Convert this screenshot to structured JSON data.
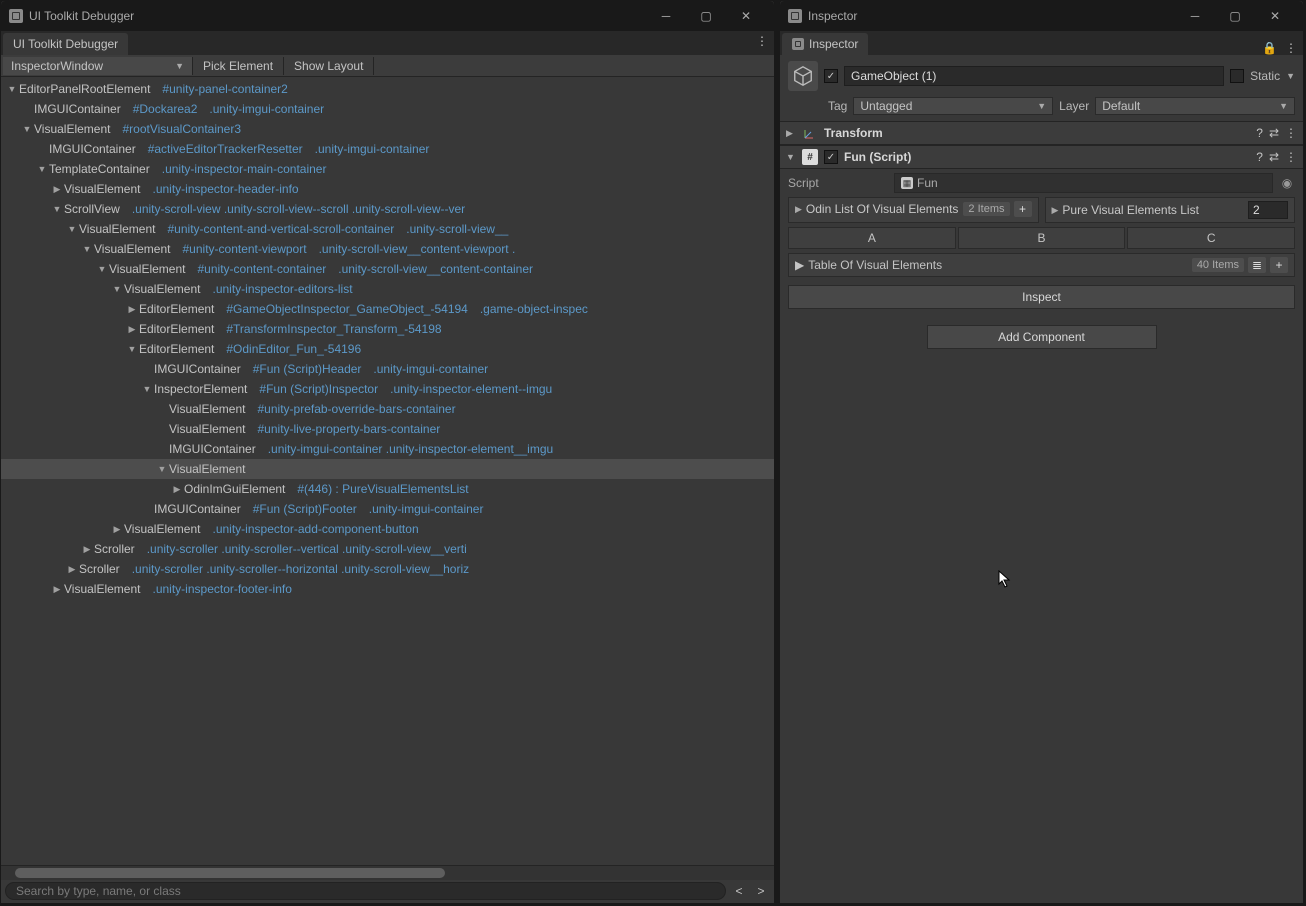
{
  "left": {
    "title": "UI Toolkit Debugger",
    "tab": "UI Toolkit Debugger",
    "dropdown": "InspectorWindow",
    "pick": "Pick Element",
    "showLayout": "Show Layout",
    "searchPlaceholder": "Search by type, name, or class",
    "nav_prev": "<",
    "nav_next": ">",
    "tree": [
      {
        "d": 0,
        "f": "▼",
        "n": "EditorPanelRootElement",
        "sel": "#unity-panel-container2"
      },
      {
        "d": 1,
        "f": "",
        "n": "IMGUIContainer",
        "sel": "#Dockarea2",
        "cls": ".unity-imgui-container"
      },
      {
        "d": 1,
        "f": "▼",
        "n": "VisualElement",
        "sel": "#rootVisualContainer3"
      },
      {
        "d": 2,
        "f": "",
        "n": "IMGUIContainer",
        "sel": "#activeEditorTrackerResetter",
        "cls": ".unity-imgui-container"
      },
      {
        "d": 2,
        "f": "▼",
        "n": "TemplateContainer",
        "cls": ".unity-inspector-main-container"
      },
      {
        "d": 3,
        "f": "▶",
        "n": "VisualElement",
        "cls": ".unity-inspector-header-info"
      },
      {
        "d": 3,
        "f": "▼",
        "n": "ScrollView",
        "cls": ".unity-scroll-view   .unity-scroll-view--scroll   .unity-scroll-view--ver"
      },
      {
        "d": 4,
        "f": "▼",
        "n": "VisualElement",
        "sel": "#unity-content-and-vertical-scroll-container",
        "cls": ".unity-scroll-view__"
      },
      {
        "d": 5,
        "f": "▼",
        "n": "VisualElement",
        "sel": "#unity-content-viewport",
        "cls": ".unity-scroll-view__content-viewport   ."
      },
      {
        "d": 6,
        "f": "▼",
        "n": "VisualElement",
        "sel": "#unity-content-container",
        "cls": ".unity-scroll-view__content-container"
      },
      {
        "d": 7,
        "f": "▼",
        "n": "VisualElement",
        "cls": ".unity-inspector-editors-list"
      },
      {
        "d": 8,
        "f": "▶",
        "n": "EditorElement",
        "sel": "#GameObjectInspector_GameObject_-54194",
        "cls": ".game-object-inspec"
      },
      {
        "d": 8,
        "f": "▶",
        "n": "EditorElement",
        "sel": "#TransformInspector_Transform_-54198"
      },
      {
        "d": 8,
        "f": "▼",
        "n": "EditorElement",
        "sel": "#OdinEditor_Fun_-54196"
      },
      {
        "d": 9,
        "f": "",
        "n": "IMGUIContainer",
        "sel": "#Fun (Script)Header",
        "cls": ".unity-imgui-container"
      },
      {
        "d": 9,
        "f": "▼",
        "n": "InspectorElement",
        "sel": "#Fun (Script)Inspector",
        "cls": ".unity-inspector-element--imgu"
      },
      {
        "d": 10,
        "f": "",
        "n": "VisualElement",
        "sel": "#unity-prefab-override-bars-container"
      },
      {
        "d": 10,
        "f": "",
        "n": "VisualElement",
        "sel": "#unity-live-property-bars-container"
      },
      {
        "d": 10,
        "f": "",
        "n": "IMGUIContainer",
        "cls": ".unity-imgui-container   .unity-inspector-element__imgu"
      },
      {
        "d": 10,
        "f": "▼",
        "n": "VisualElement",
        "selected": true
      },
      {
        "d": 11,
        "f": "▶",
        "n": "OdinImGuiElement",
        "sel": "#(446) : PureVisualElementsList"
      },
      {
        "d": 9,
        "f": "",
        "n": "IMGUIContainer",
        "sel": "#Fun (Script)Footer",
        "cls": ".unity-imgui-container"
      },
      {
        "d": 7,
        "f": "▶",
        "n": "VisualElement",
        "cls": ".unity-inspector-add-component-button"
      },
      {
        "d": 5,
        "f": "▶",
        "n": "Scroller",
        "cls": ".unity-scroller   .unity-scroller--vertical   .unity-scroll-view__verti"
      },
      {
        "d": 4,
        "f": "▶",
        "n": "Scroller",
        "cls": ".unity-scroller   .unity-scroller--horizontal   .unity-scroll-view__horiz"
      },
      {
        "d": 3,
        "f": "▶",
        "n": "VisualElement",
        "cls": ".unity-inspector-footer-info"
      }
    ]
  },
  "right": {
    "title": "Inspector",
    "tab": "Inspector",
    "goName": "GameObject (1)",
    "static": "Static",
    "tag": "Tag",
    "tagVal": "Untagged",
    "layer": "Layer",
    "layerVal": "Default",
    "transform": "Transform",
    "fun": "Fun (Script)",
    "script": "Script",
    "scriptVal": "Fun",
    "odinList": "Odin List Of Visual Elements",
    "odinCount": "2 Items",
    "pureList": "Pure Visual Elements List",
    "pureCount": "2",
    "cols": [
      "A",
      "B",
      "C"
    ],
    "table": "Table Of Visual Elements",
    "tableCount": "40 Items",
    "inspect": "Inspect",
    "addComp": "Add Component"
  }
}
